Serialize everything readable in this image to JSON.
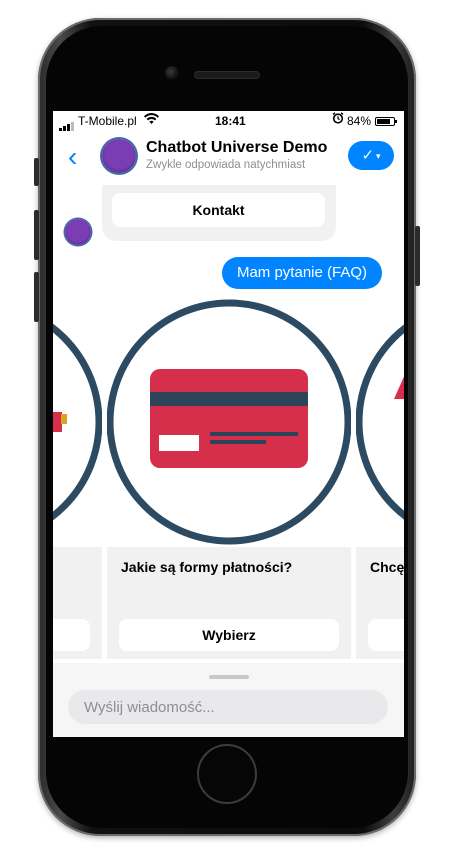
{
  "status_bar": {
    "carrier": "T-Mobile.pl",
    "time": "18:41",
    "battery_percent": "84%",
    "battery_level": 0.84,
    "wifi_icon": "wifi-icon",
    "alarm_icon": "alarm-icon"
  },
  "header": {
    "back_icon": "‹",
    "title": "Chatbot Universe Demo",
    "subtitle": "Zwykle odpowiada natychmiast",
    "check_icon": "✓",
    "caret_icon": "▾"
  },
  "messages": {
    "contact_button": "Kontakt",
    "user_message": "Mam pytanie (FAQ)"
  },
  "carousel": {
    "cards": [
      {
        "title": "",
        "button": ""
      },
      {
        "title": "Jakie są formy płatności?",
        "button": "Wybierz"
      },
      {
        "title": "Chcę",
        "button": ""
      }
    ]
  },
  "composer": {
    "placeholder": "Wyślij wiadomość..."
  },
  "colors": {
    "accent": "#0084ff",
    "circle_stroke": "#2c4b63",
    "card_red": "#d52f4b",
    "card_stripe": "#2e4458"
  }
}
